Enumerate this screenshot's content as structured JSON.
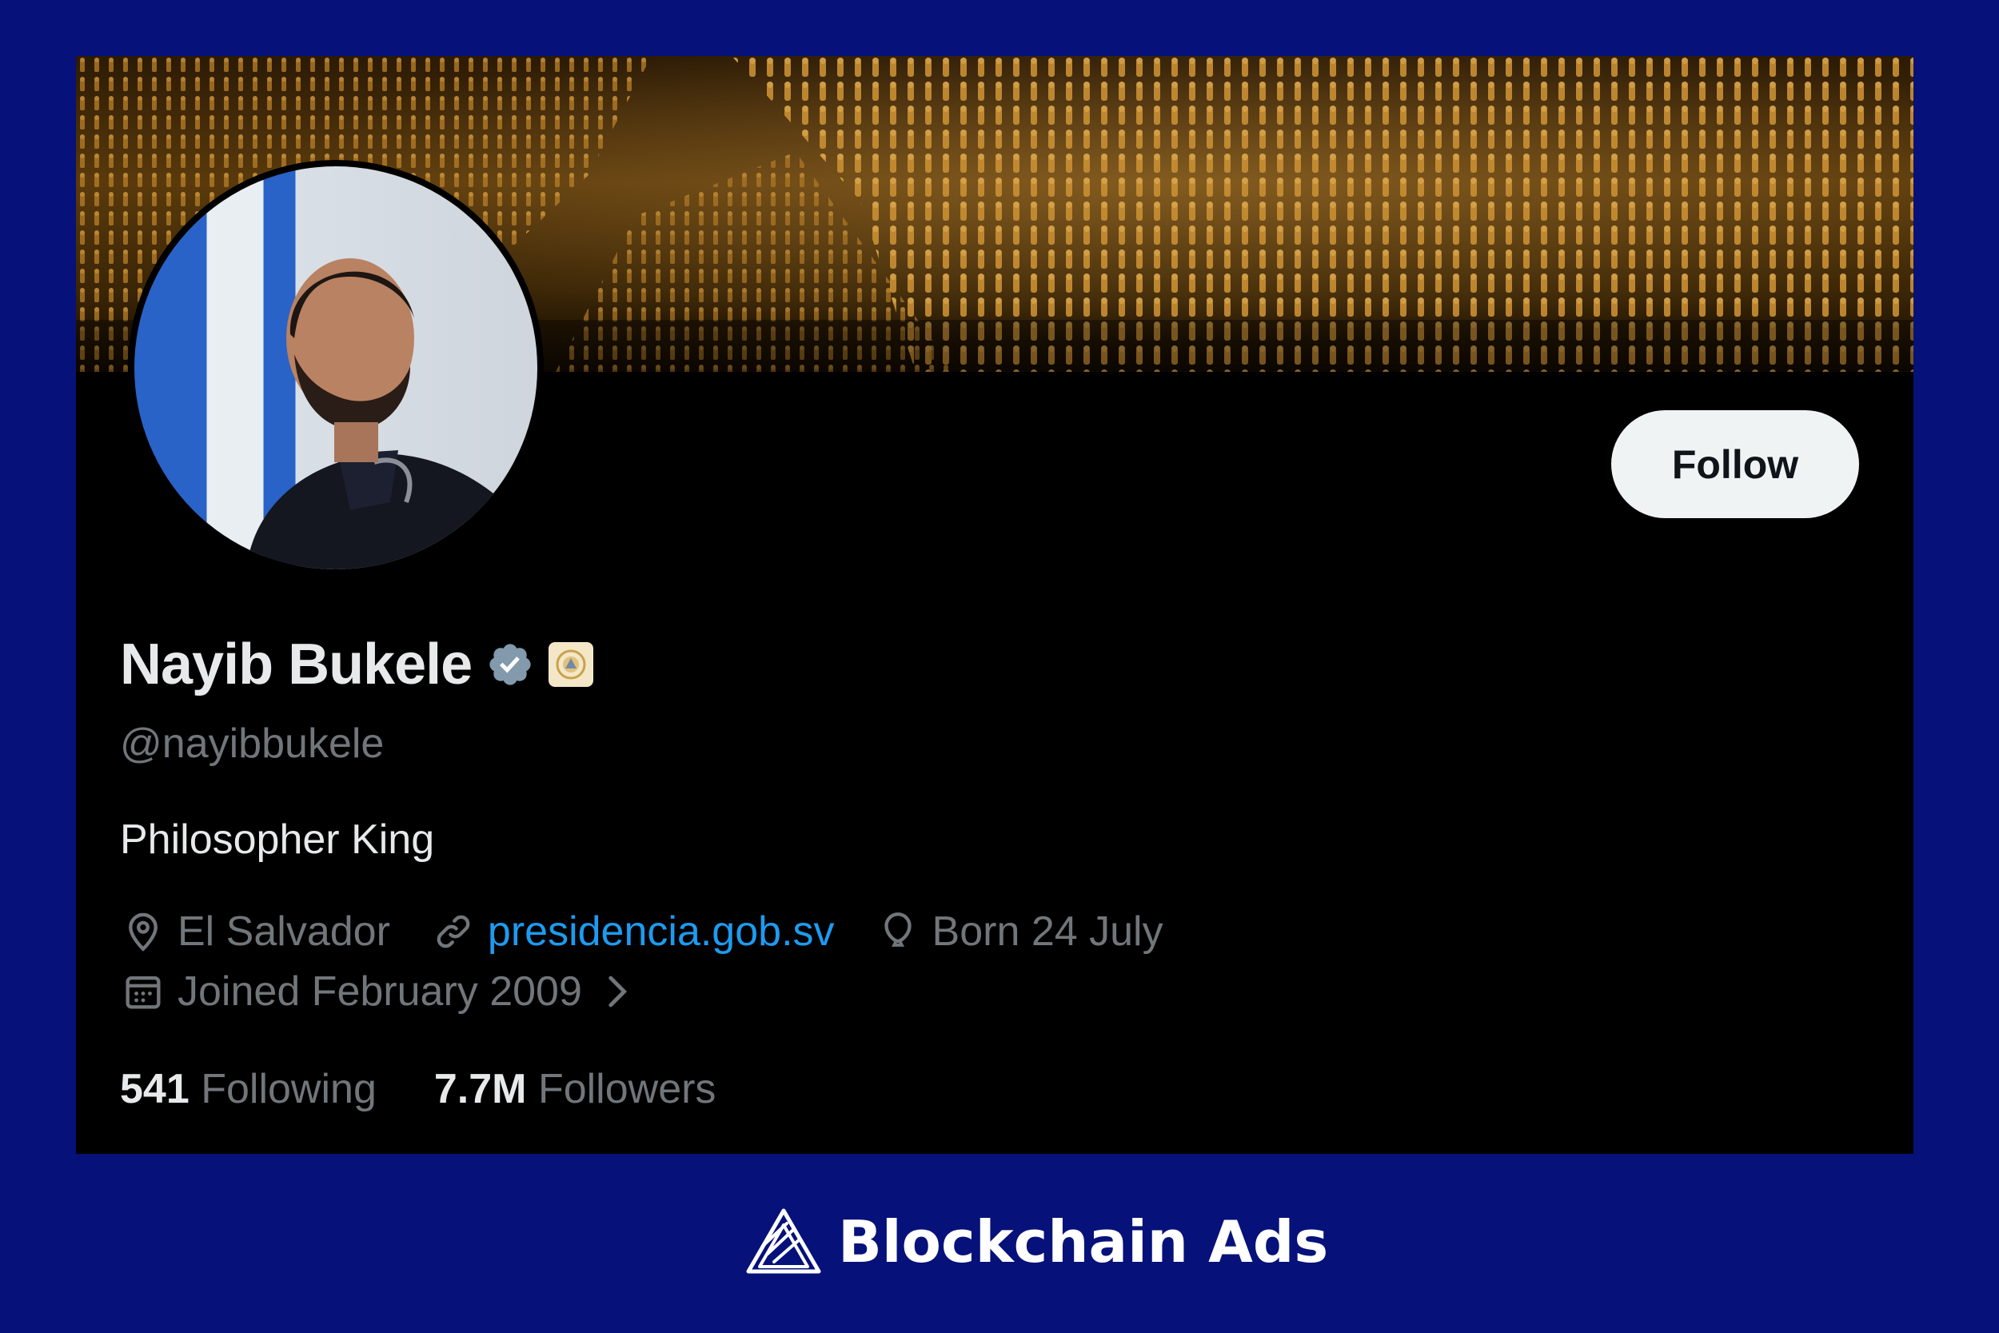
{
  "profile": {
    "display_name": "Nayib Bukele",
    "handle": "@nayibbukele",
    "bio": "Philosopher King",
    "location": "El Salvador",
    "website": "presidencia.gob.sv",
    "birthday": "Born 24 July",
    "joined": "Joined February 2009",
    "follow_label": "Follow",
    "verified_icon": "verified-badge-icon",
    "affiliation_icon": "government-seal-icon"
  },
  "stats": {
    "following_count": "541",
    "following_label": "Following",
    "followers_count": "7.7M",
    "followers_label": "Followers"
  },
  "brand": {
    "name": "Blockchain Ads",
    "logo_icon": "blockchain-ads-logo-icon"
  },
  "colors": {
    "page_background": "#06117a",
    "card_background": "#000000",
    "link": "#1d9bf0",
    "muted_text": "#71767b",
    "primary_text": "#e7e9ea",
    "verified_badge": "#829aab"
  }
}
